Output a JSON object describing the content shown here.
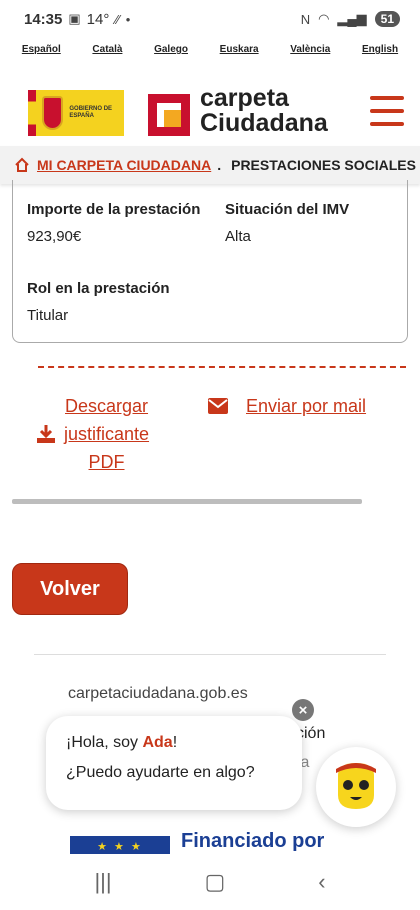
{
  "status_bar": {
    "time": "14:35",
    "temperature": "14°",
    "battery": "51"
  },
  "languages": [
    "Español",
    "Català",
    "Galego",
    "Euskara",
    "València",
    "English"
  ],
  "header": {
    "gov_logo_text": "GOBIERNO DE ESPAÑA",
    "brand_line1": "carpeta",
    "brand_line2": "Ciudadana"
  },
  "breadcrumb": {
    "link": "MI CARPETA CIUDADANA",
    "separator": ".",
    "current": "PRESTACIONES SOCIALES"
  },
  "card": {
    "importe_label": "Importe de la prestación",
    "importe_value": "923,90€",
    "situacion_label": "Situación del IMV",
    "situacion_value": "Alta",
    "rol_label": "Rol en la prestación",
    "rol_value": "Titular"
  },
  "actions": {
    "download_l1": "Descargar",
    "download_l2": "justificante",
    "download_l3": "PDF",
    "mail": "Enviar por mail"
  },
  "back_button": "Volver",
  "footer": {
    "url": "carpetaciudadana.gob.es",
    "behind_text_1": "ción",
    "behind_text_2": "ta"
  },
  "chat": {
    "greeting_pre": "¡Hola, soy ",
    "name": "Ada",
    "greeting_post": "!",
    "question": "¿Puedo ayudarte en algo?",
    "close": "×"
  },
  "eu_banner": {
    "stars": "★ ★ ★",
    "text": "Financiado por"
  },
  "colors": {
    "accent": "#c8371a",
    "eu_blue": "#1b3f94"
  }
}
